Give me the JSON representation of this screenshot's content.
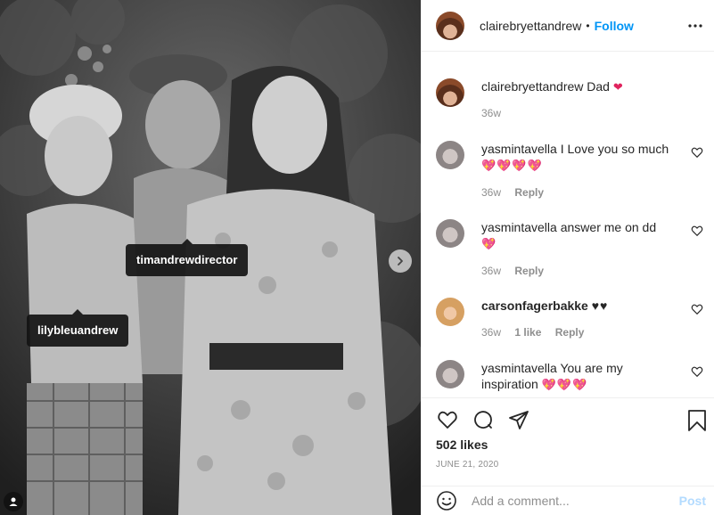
{
  "post": {
    "username": "clairebryettandrew",
    "follow_label": "Follow",
    "separator": "•",
    "tags": [
      {
        "label": "timandrewdirector"
      },
      {
        "label": "lilybleuandrew"
      }
    ],
    "icons": {
      "more": "more-horizontal-icon",
      "next": "chevron-right-icon",
      "user_tag": "user-tag-icon"
    }
  },
  "caption": {
    "username": "clairebryettandrew",
    "text": "Dad",
    "emoji": "❤",
    "time": "36w"
  },
  "comments": [
    {
      "username": "yasmintavella",
      "text": "I Love you so much",
      "emoji": "💖💖💖💖",
      "time": "36w",
      "reply": "Reply",
      "likes": ""
    },
    {
      "username": "yasmintavella",
      "text": "answer me on dd",
      "emoji": "💖",
      "time": "36w",
      "reply": "Reply",
      "likes": ""
    },
    {
      "username": "carsonfagerbakke",
      "text": "♥♥",
      "emoji": "",
      "time": "36w",
      "reply": "Reply",
      "likes": "1 like"
    },
    {
      "username": "yasmintavella",
      "text": "You are my inspiration",
      "emoji": "💖💖💖",
      "time": "",
      "reply": "",
      "likes": ""
    }
  ],
  "actions": {
    "likes_text": "502 likes",
    "date_text": "JUNE 21, 2020"
  },
  "composer": {
    "placeholder": "Add a comment...",
    "post_label": "Post"
  },
  "colors": {
    "accent": "#0095f6",
    "post_disabled": "#b3dbff",
    "muted": "#8e8e8e",
    "heart": "#e0245e"
  }
}
